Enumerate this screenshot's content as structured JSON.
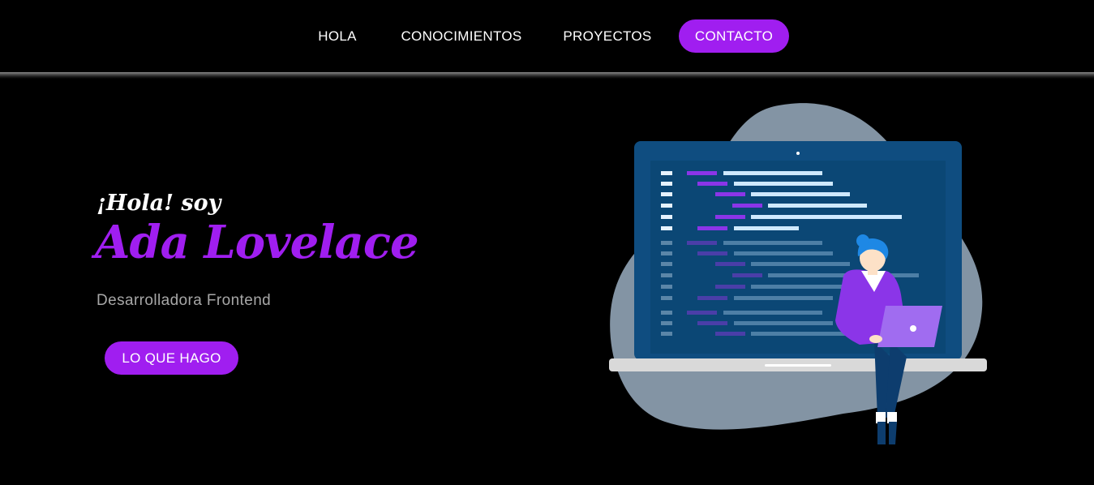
{
  "nav": {
    "items": [
      {
        "label": "HOLA"
      },
      {
        "label": "CONOCIMIENTOS"
      },
      {
        "label": "PROYECTOS"
      },
      {
        "label": "CONTACTO"
      }
    ],
    "active": "CONTACTO"
  },
  "hero": {
    "greeting": "¡Hola! soy",
    "name": "Ada Lovelace",
    "role": "Desarrolladora Frontend",
    "cta_label": "LO QUE HAGO"
  },
  "illustration": {
    "subject": "developer-at-laptop-illustration"
  },
  "colors": {
    "background": "#000000",
    "accent": "#a01ef0",
    "text": "#ffffff",
    "muted": "#a7a7a7",
    "blob": "#8394a4",
    "screen": "#0b4775",
    "laptop_frame": "#0f4d80"
  }
}
